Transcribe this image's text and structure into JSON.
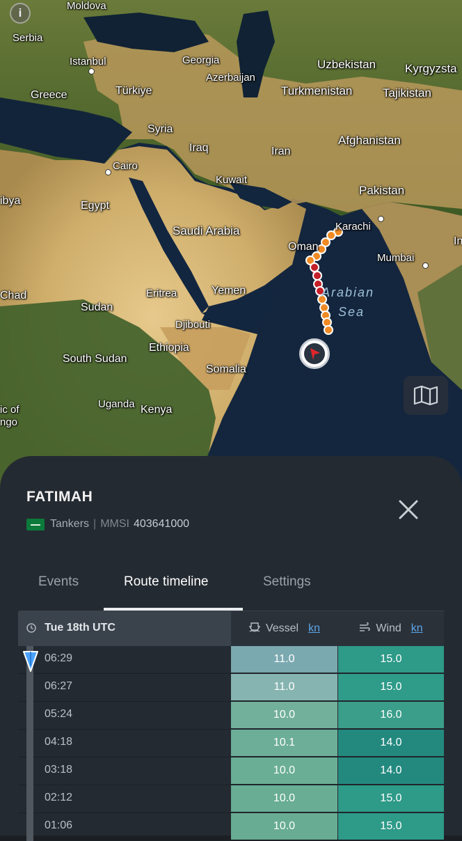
{
  "map": {
    "countries": [
      "Moldova",
      "Serbia",
      "Greece",
      "Türkiye",
      "Georgia",
      "Azerbaijan",
      "Uzbekistan",
      "Kyrgyzsta",
      "Turkmenistan",
      "Tajikistan",
      "Syria",
      "Iraq",
      "Iran",
      "Afghanistan",
      "Kuwait",
      "Pakistan",
      "ibya",
      "Egypt",
      "Saudi Arabia",
      "Oman",
      "Chad",
      "Sudan",
      "Eritrea",
      "Yemen",
      "Djibouti",
      "Ethiopia",
      "South Sudan",
      "Somalia",
      "Uganda",
      "Kenya",
      "ic of",
      "ngo",
      "In"
    ],
    "cities": [
      "Istanbul",
      "Cairo",
      "Karachi",
      "Mumbai"
    ],
    "sea": [
      "Arabian",
      "Sea"
    ],
    "info_icon": "info-icon",
    "layers_icon": "map-icon"
  },
  "vessel": {
    "name": "FATIMAH",
    "type": "Tankers",
    "mmsi_label": "MMSI",
    "mmsi": "403641000",
    "flag": "saudi-arabia-flag"
  },
  "tabs": [
    "Events",
    "Route timeline",
    "Settings"
  ],
  "active_tab": "Route timeline",
  "timeline": {
    "date_label": "Tue 18th UTC",
    "vessel_label": "Vessel",
    "wind_label": "Wind",
    "unit": "kn",
    "rows": [
      {
        "time": "06:29",
        "vessel": "11.0",
        "wind": "15.0"
      },
      {
        "time": "06:27",
        "vessel": "11.0",
        "wind": "15.0"
      },
      {
        "time": "05:24",
        "vessel": "10.0",
        "wind": "16.0"
      },
      {
        "time": "04:18",
        "vessel": "10.1",
        "wind": "14.0"
      },
      {
        "time": "03:18",
        "vessel": "10.0",
        "wind": "14.0"
      },
      {
        "time": "02:12",
        "vessel": "10.0",
        "wind": "15.0"
      },
      {
        "time": "01:06",
        "vessel": "10.0",
        "wind": "15.0"
      }
    ]
  },
  "colors": {
    "vessel_cells": [
      "#7ba9b0",
      "#86b4b0",
      "#72b09b",
      "#6cae98",
      "#6aae96",
      "#68ad94",
      "#67ac93"
    ],
    "wind_cells": [
      "#2e9a88",
      "#2f9b89",
      "#3a9e8a",
      "#23897f",
      "#23897f",
      "#2e9a88",
      "#2e9a88"
    ],
    "track_orange": "#f08a24",
    "track_red": "#c4202a",
    "accent_blue": "#5aa6e8"
  }
}
